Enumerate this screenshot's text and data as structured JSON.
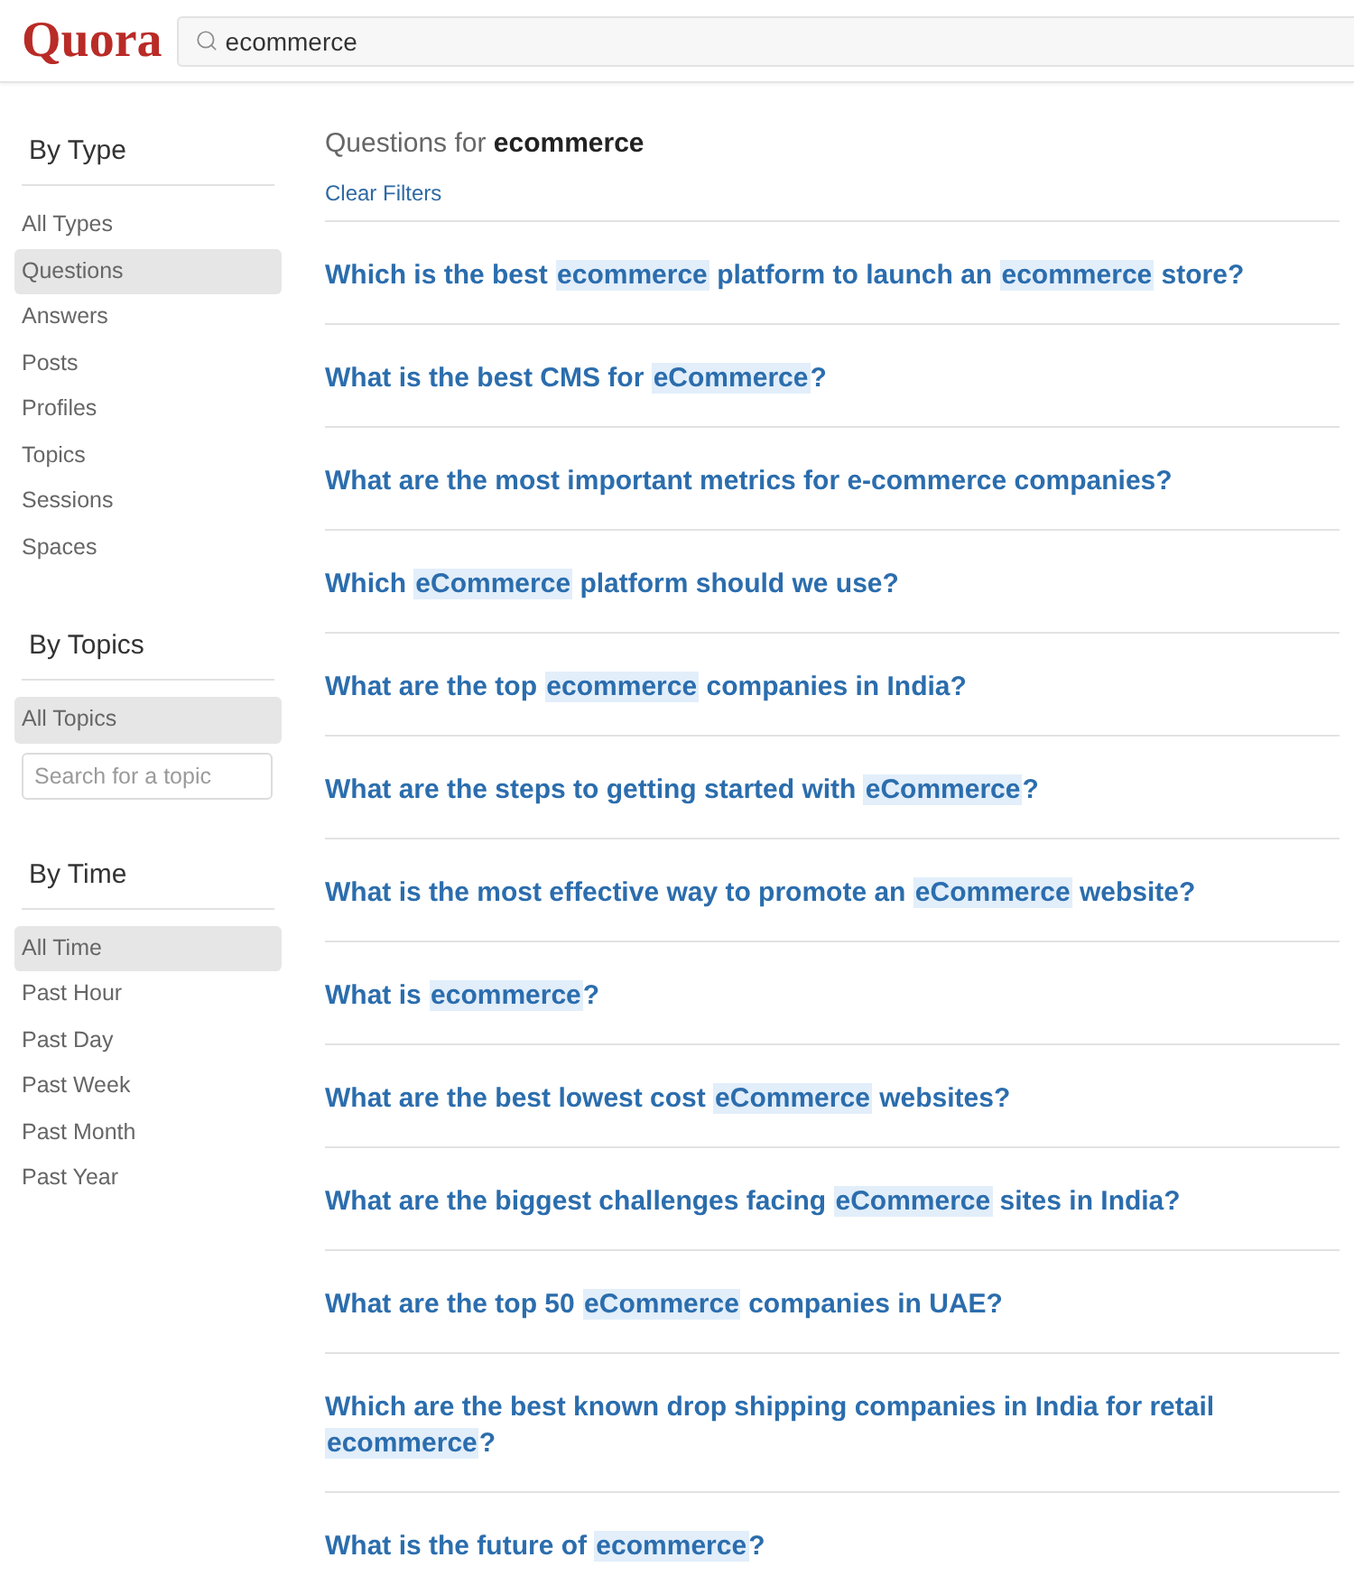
{
  "header": {
    "logo": "Quora",
    "search": {
      "value": "ecommerce"
    }
  },
  "sidebar": {
    "sections": [
      {
        "title": "By Type",
        "items": [
          {
            "label": "All Types",
            "selected": false
          },
          {
            "label": "Questions",
            "selected": true
          },
          {
            "label": "Answers",
            "selected": false
          },
          {
            "label": "Posts",
            "selected": false
          },
          {
            "label": "Profiles",
            "selected": false
          },
          {
            "label": "Topics",
            "selected": false
          },
          {
            "label": "Sessions",
            "selected": false
          },
          {
            "label": "Spaces",
            "selected": false
          }
        ]
      },
      {
        "title": "By Topics",
        "items": [
          {
            "label": "All Topics",
            "selected": true
          }
        ],
        "search": {
          "placeholder": "Search for a topic"
        }
      },
      {
        "title": "By Time",
        "items": [
          {
            "label": "All Time",
            "selected": true
          },
          {
            "label": "Past Hour",
            "selected": false
          },
          {
            "label": "Past Day",
            "selected": false
          },
          {
            "label": "Past Week",
            "selected": false
          },
          {
            "label": "Past Month",
            "selected": false
          },
          {
            "label": "Past Year",
            "selected": false
          }
        ]
      }
    ]
  },
  "results": {
    "heading": "Questions for **ecommerce**",
    "clear_filters": "Clear Filters",
    "questions": [
      {
        "segments": [
          {
            "text": "Which is the best ",
            "highlighted": false
          },
          {
            "text": "ecommerce",
            "highlighted": true
          },
          {
            "text": " platform to launch an ",
            "highlighted": false
          },
          {
            "text": "ecommerce",
            "highlighted": true
          },
          {
            "text": " store?",
            "highlighted": false
          }
        ]
      },
      {
        "segments": [
          {
            "text": "What is the best CMS for ",
            "highlighted": false
          },
          {
            "text": "eCommerce",
            "highlighted": true
          },
          {
            "text": "?",
            "highlighted": false
          }
        ]
      },
      {
        "segments": [
          {
            "text": "What are the most important metrics for e-commerce companies?",
            "highlighted": false
          }
        ]
      },
      {
        "segments": [
          {
            "text": "Which ",
            "highlighted": false
          },
          {
            "text": "eCommerce",
            "highlighted": true
          },
          {
            "text": " platform should we use?",
            "highlighted": false
          }
        ]
      },
      {
        "segments": [
          {
            "text": "What are the top ",
            "highlighted": false
          },
          {
            "text": "ecommerce",
            "highlighted": true
          },
          {
            "text": " companies in India?",
            "highlighted": false
          }
        ]
      },
      {
        "segments": [
          {
            "text": "What are the steps to getting started with ",
            "highlighted": false
          },
          {
            "text": "eCommerce",
            "highlighted": true
          },
          {
            "text": "?",
            "highlighted": false
          }
        ]
      },
      {
        "segments": [
          {
            "text": "What is the most effective way to promote an ",
            "highlighted": false
          },
          {
            "text": "eCommerce",
            "highlighted": true
          },
          {
            "text": " website?",
            "highlighted": false
          }
        ]
      },
      {
        "segments": [
          {
            "text": "What is ",
            "highlighted": false
          },
          {
            "text": "ecommerce",
            "highlighted": true
          },
          {
            "text": "?",
            "highlighted": false
          }
        ]
      },
      {
        "segments": [
          {
            "text": "What are the best lowest cost ",
            "highlighted": false
          },
          {
            "text": "eCommerce",
            "highlighted": true
          },
          {
            "text": " websites?",
            "highlighted": false
          }
        ]
      },
      {
        "segments": [
          {
            "text": "What are the biggest challenges facing ",
            "highlighted": false
          },
          {
            "text": "eCommerce",
            "highlighted": true
          },
          {
            "text": " sites in India?",
            "highlighted": false
          }
        ]
      },
      {
        "segments": [
          {
            "text": "What are the top 50 ",
            "highlighted": false
          },
          {
            "text": "eCommerce",
            "highlighted": true
          },
          {
            "text": " companies in UAE?",
            "highlighted": false
          }
        ]
      },
      {
        "segments": [
          {
            "text": "Which are the best known drop shipping companies in India for retail ",
            "highlighted": false
          },
          {
            "text": "ecommerce",
            "highlighted": true
          },
          {
            "text": "?",
            "highlighted": false
          }
        ]
      },
      {
        "segments": [
          {
            "text": "What is the future of ",
            "highlighted": false
          },
          {
            "text": "ecommerce",
            "highlighted": true
          },
          {
            "text": "?",
            "highlighted": false
          }
        ]
      }
    ]
  }
}
